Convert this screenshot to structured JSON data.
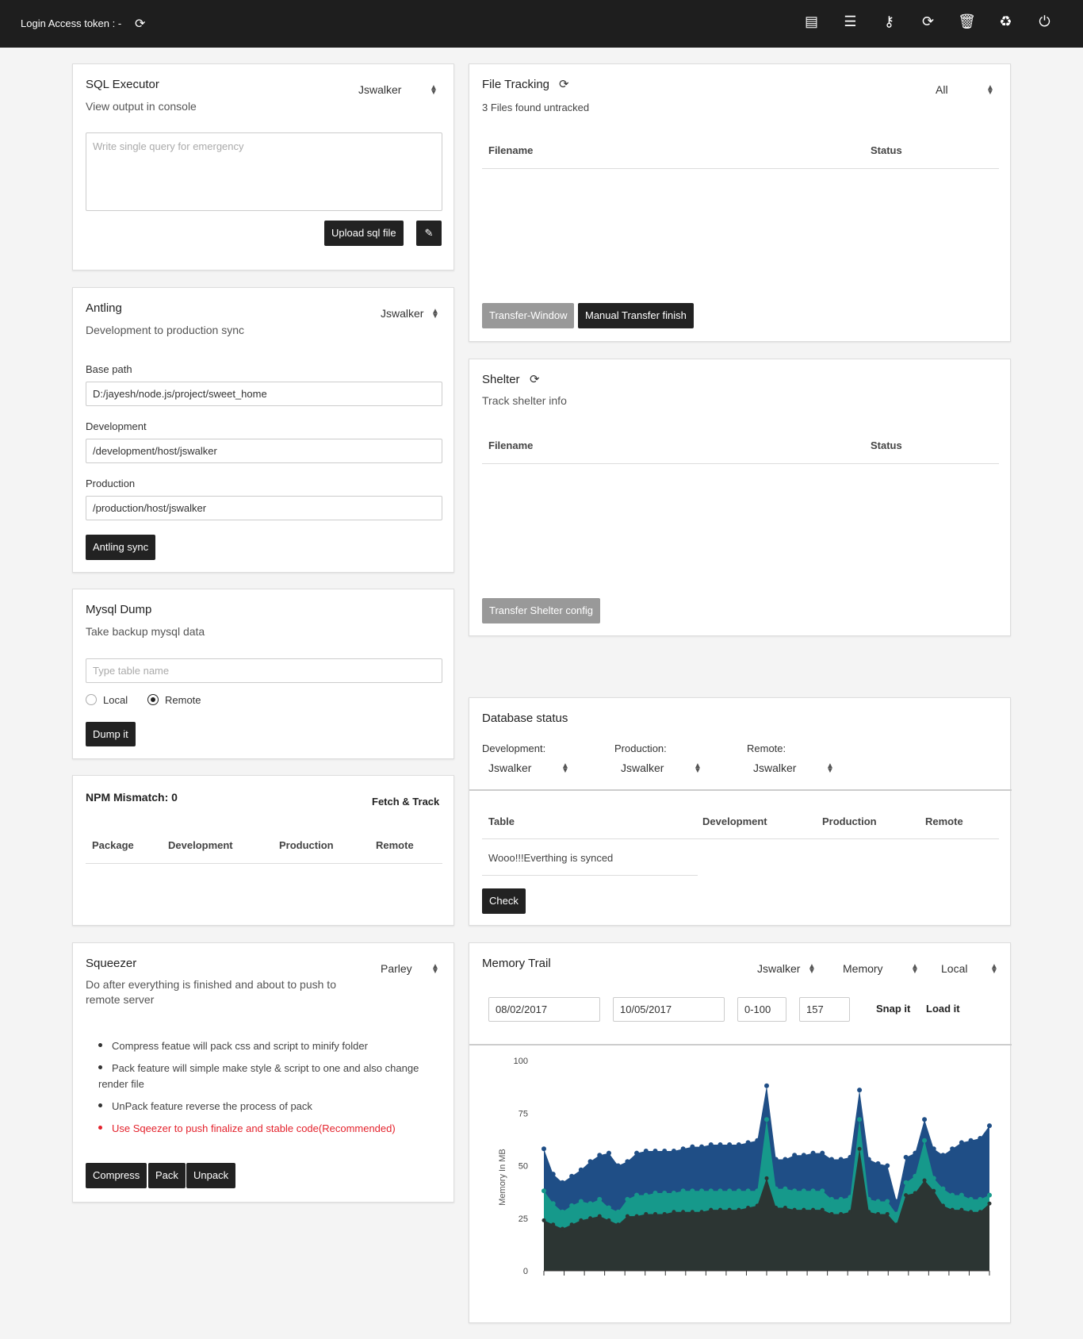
{
  "topbar": {
    "token_label": "Login Access token : -",
    "icons": [
      "book-icon",
      "server-icon",
      "key-icon",
      "refresh-icon",
      "trash-icon",
      "recycle-icon",
      "power-icon"
    ]
  },
  "sql_executor": {
    "title": "SQL Executor",
    "subtitle": "View output in console",
    "select_value": "Jswalker",
    "textarea_placeholder": "Write single query for emergency",
    "upload_label": "Upload sql file"
  },
  "antling": {
    "title": "Antling",
    "subtitle": "Development to production sync",
    "select_value": "Jswalker",
    "base_path_label": "Base path",
    "base_path_value": "D:/jayesh/node.js/project/sweet_home",
    "development_label": "Development",
    "development_value": "/development/host/jswalker",
    "production_label": "Production",
    "production_value": "/production/host/jswalker",
    "sync_label": "Antling sync"
  },
  "mysql_dump": {
    "title": "Mysql Dump",
    "subtitle": "Take backup mysql data",
    "placeholder": "Type table name",
    "local_label": "Local",
    "remote_label": "Remote",
    "selected": "Remote",
    "dump_label": "Dump it"
  },
  "npm": {
    "title": "NPM Mismatch: 0",
    "fetch_label": "Fetch & Track",
    "columns": [
      "Package",
      "Development",
      "Production",
      "Remote"
    ]
  },
  "squeezer": {
    "title": "Squeezer",
    "subtitle_line1": "Do after everything is finished and about to push to",
    "subtitle_line2": "remote server",
    "select_value": "Parley",
    "bullets": [
      "Compress featue will pack css and script to minify folder",
      "Pack feature will simple make style & script to one and also change",
      "render file",
      "UnPack feature reverse the process of pack",
      "Use Sqeezer to push finalize and stable code(Recommended)"
    ],
    "buttons": [
      "Compress",
      "Pack",
      "Unpack"
    ]
  },
  "file_tracking": {
    "title": "File Tracking",
    "count_text": "3 Files found untracked",
    "select_value": "All",
    "columns": [
      "Filename",
      "Status"
    ],
    "transfer_window_label": "Transfer-Window",
    "manual_finish_label": "Manual Transfer finish"
  },
  "shelter": {
    "title": "Shelter",
    "subtitle": "Track shelter info",
    "columns": [
      "Filename",
      "Status"
    ],
    "transfer_label": "Transfer Shelter config"
  },
  "database_status": {
    "title": "Database status",
    "development_label": "Development:",
    "development_value": "Jswalker",
    "production_label": "Production:",
    "production_value": "Jswalker",
    "remote_label": "Remote:",
    "remote_value": "Jswalker",
    "columns": [
      "Table",
      "Development",
      "Production",
      "Remote"
    ],
    "synced_text": "Wooo!!!Everthing is synced",
    "check_label": "Check"
  },
  "memory_trail": {
    "title": "Memory Trail",
    "select_user": "Jswalker",
    "select_metric": "Memory",
    "select_env": "Local",
    "date_from": "08/02/2017",
    "date_to": "10/05/2017",
    "range": "0-100",
    "limit": "157",
    "snap_label": "Snap it",
    "load_label": "Load it"
  },
  "chart_data": {
    "type": "area",
    "ylabel": "Memory In MB",
    "ylim": [
      0,
      100
    ],
    "yticks": [
      0,
      25,
      50,
      75,
      100
    ],
    "series": [
      {
        "color": "#1f4e86",
        "values": [
          58,
          46,
          42,
          45,
          48,
          52,
          55,
          56,
          50,
          52,
          56,
          57,
          57,
          57,
          57,
          58,
          59,
          59,
          60,
          60,
          60,
          60,
          61,
          62,
          88,
          53,
          53,
          55,
          55,
          56,
          56,
          53,
          53,
          54,
          86,
          53,
          51,
          50,
          33,
          54,
          56,
          72,
          58,
          55,
          58,
          61,
          62,
          63,
          69
        ]
      },
      {
        "color": "#16998b",
        "values": [
          38,
          32,
          28,
          31,
          33,
          32,
          34,
          30,
          28,
          34,
          36,
          36,
          37,
          37,
          37,
          38,
          38,
          38,
          38,
          38,
          38,
          38,
          38,
          38,
          72,
          39,
          39,
          38,
          38,
          38,
          38,
          34,
          34,
          35,
          72,
          34,
          33,
          33,
          27,
          42,
          45,
          62,
          44,
          39,
          36,
          36,
          34,
          34,
          36
        ]
      },
      {
        "color": "#2c3533",
        "values": [
          24,
          22,
          20,
          22,
          24,
          25,
          26,
          24,
          22,
          26,
          26,
          27,
          27,
          27,
          28,
          28,
          28,
          28,
          29,
          29,
          29,
          29,
          30,
          31,
          44,
          30,
          30,
          29,
          29,
          29,
          29,
          27,
          27,
          28,
          58,
          28,
          27,
          27,
          22,
          36,
          37,
          43,
          38,
          31,
          29,
          29,
          28,
          28,
          32
        ]
      }
    ]
  }
}
